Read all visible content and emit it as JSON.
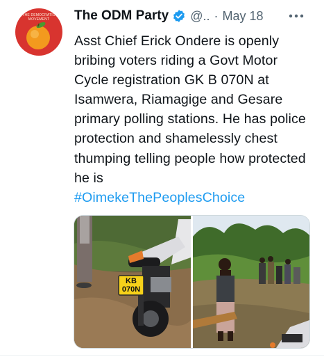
{
  "account": {
    "name": "The ODM Party",
    "handle": "@..",
    "separator": "·",
    "date": "May 18",
    "avatar_text": "THE DEMOCRATIC MOVEMENT"
  },
  "tweet": {
    "text": "Asst Chief Erick Ondere is openly bribing voters riding a Govt Motor Cycle registration GK B 070N at Isamwera, Riamagige and Gesare primary  polling stations. He has police protection and shamelessly chest thumping telling people how protected he is",
    "hashtag": "#OimekeThePeoplesChoice"
  },
  "media": {
    "plate_line1": "KB",
    "plate_line2": "070N"
  },
  "icons": {
    "verified": "verified-badge-icon",
    "more": "more-options-icon"
  },
  "colors": {
    "accent": "#1d9bf0",
    "secondary_text": "#536471",
    "avatar_bg": "#d8342f",
    "orange": "#f39a1e"
  }
}
